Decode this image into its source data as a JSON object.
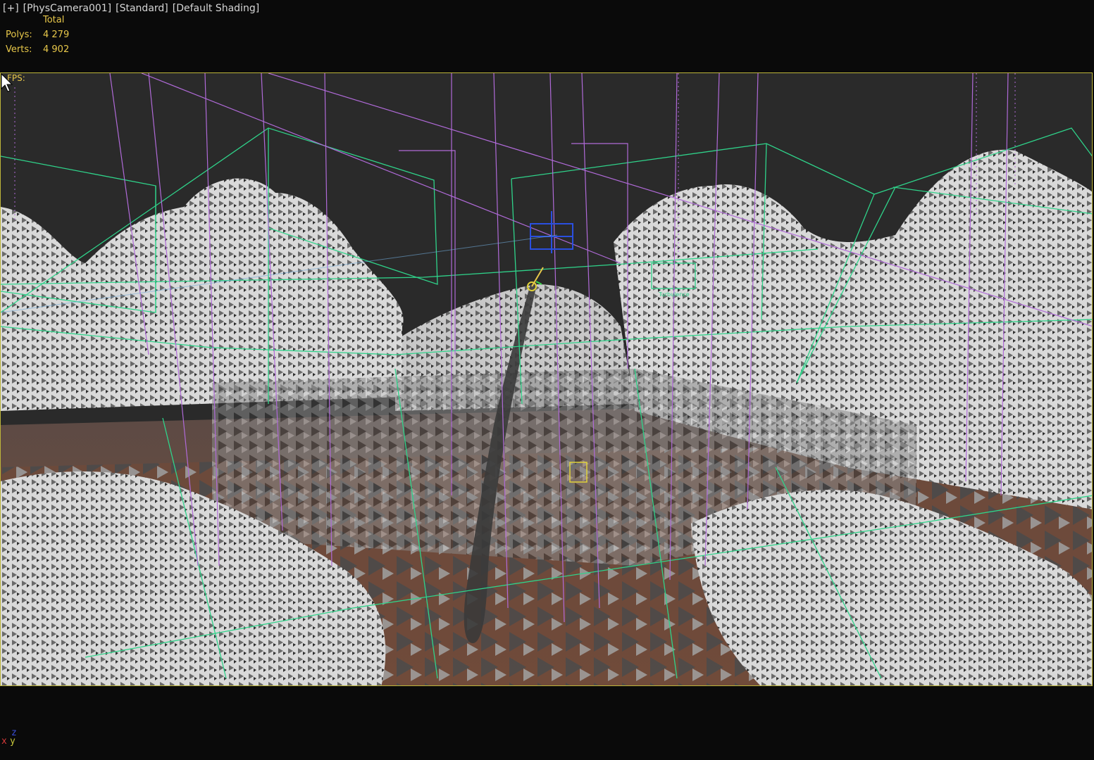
{
  "viewport_label": {
    "maximize": "[+]",
    "camera": "[PhysCamera001]",
    "preset": "[Standard]",
    "shading": "[Default Shading]"
  },
  "stats": {
    "header": "Total",
    "polys_label": "Polys:",
    "polys_value": "4 279",
    "verts_label": "Verts:",
    "verts_value": "4 902"
  },
  "fps_label": "FPS:",
  "scene_labels": {
    "turbulence": "Turbulence"
  },
  "axis_gizmo": {
    "z": "z",
    "x": "x",
    "y": "y"
  },
  "colors": {
    "frame": "#bdb53a",
    "overlay_text": "#e8c84a",
    "helper_green": "#2fd38a",
    "helper_purple": "#b06ad8",
    "ground": "#6e4a3a",
    "foliage": "#d8d8d8",
    "sky": "#2a2a2a"
  }
}
